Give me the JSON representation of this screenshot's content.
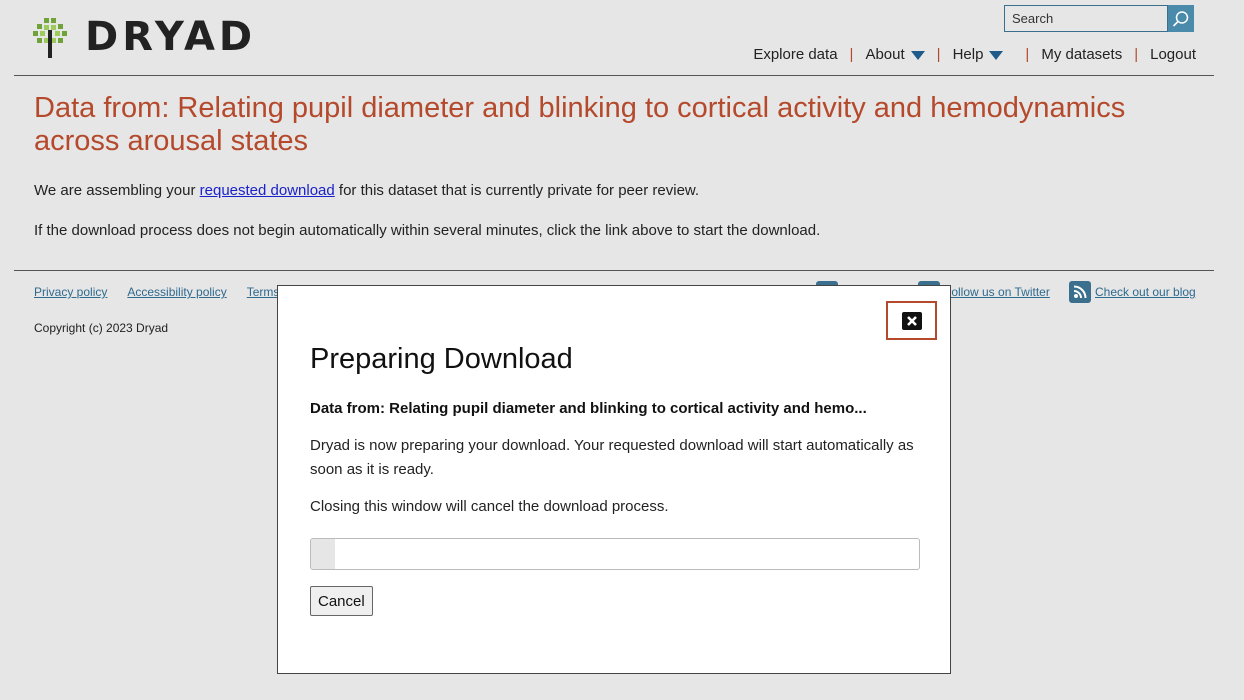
{
  "header": {
    "brand": "DRYAD",
    "search_placeholder": "Search",
    "nav": {
      "explore": "Explore data",
      "about": "About",
      "help": "Help",
      "my_datasets": "My datasets",
      "logout": "Logout",
      "separator": "|"
    }
  },
  "page": {
    "title": "Data from: Relating pupil diameter and blinking to cortical activity and hemodynamics across arousal states",
    "para1_before": "We are assembling your ",
    "para1_link": "requested download",
    "para1_after": " for this dataset that is currently private for peer review.",
    "para2": "If the download process does not begin automatically within several minutes, click the link above to start the download."
  },
  "footer": {
    "links": [
      "Privacy policy",
      "Accessibility policy",
      "Terms"
    ],
    "copyright": "Copyright (c) 2023 Dryad",
    "twitter": "Follow us on Twitter",
    "blog": "Check out our blog"
  },
  "modal": {
    "title": "Preparing Download",
    "subtitle": "Data from: Relating pupil diameter and blinking to cortical activity and hemo...",
    "body1": "Dryad is now preparing your download. Your requested download will start automatically as soon as it is ready.",
    "body2": "Closing this window will cancel the download process.",
    "progress_fraction": 0.04,
    "cancel_label": "Cancel"
  },
  "colors": {
    "accent": "#b5492c",
    "link": "#1a22c9",
    "nav_blue": "#1e5b8a",
    "search_button": "#4a8aab"
  },
  "icons": {
    "logo": "tree-logo-icon",
    "search": "search-icon",
    "close": "close-icon",
    "caret": "caret-down-icon",
    "rss": "rss-icon",
    "twitter": "twitter-icon"
  }
}
